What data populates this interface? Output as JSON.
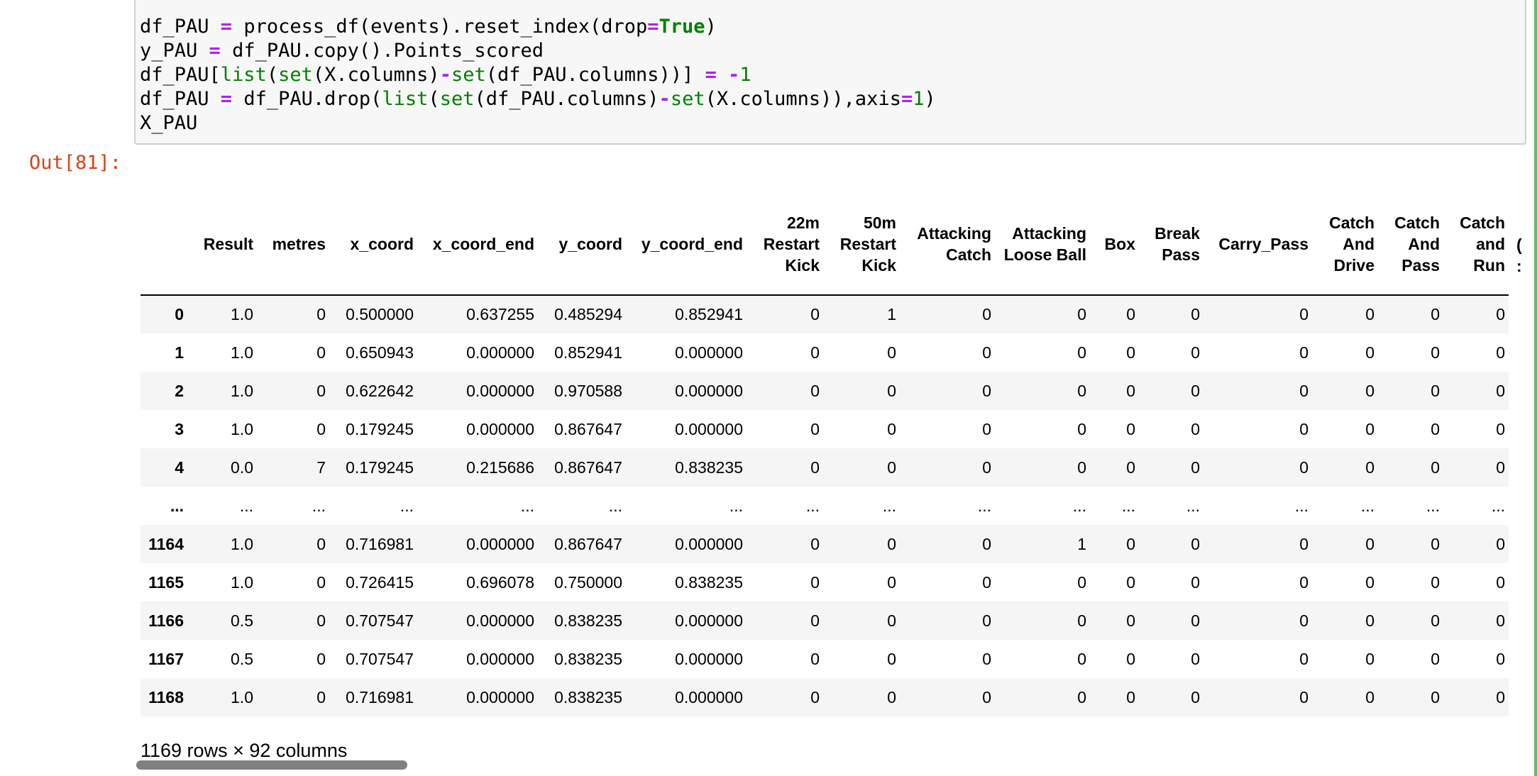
{
  "code_cell": {
    "lines": [
      [
        {
          "t": "df_PAU ",
          "c": ""
        },
        {
          "t": "=",
          "c": "op"
        },
        {
          "t": " process_df(events).reset_index(drop",
          "c": ""
        },
        {
          "t": "=",
          "c": "op"
        },
        {
          "t": "True",
          "c": "kw"
        },
        {
          "t": ")",
          "c": ""
        }
      ],
      [
        {
          "t": "y_PAU ",
          "c": ""
        },
        {
          "t": "=",
          "c": "op"
        },
        {
          "t": " df_PAU.copy().Points_scored",
          "c": ""
        }
      ],
      [
        {
          "t": "df_PAU[",
          "c": ""
        },
        {
          "t": "list",
          "c": "bi"
        },
        {
          "t": "(",
          "c": ""
        },
        {
          "t": "set",
          "c": "bi"
        },
        {
          "t": "(X.columns)",
          "c": ""
        },
        {
          "t": "-",
          "c": "op"
        },
        {
          "t": "set",
          "c": "bi"
        },
        {
          "t": "(df_PAU.columns))] ",
          "c": ""
        },
        {
          "t": "=",
          "c": "op"
        },
        {
          "t": " ",
          "c": ""
        },
        {
          "t": "-",
          "c": "op"
        },
        {
          "t": "1",
          "c": "num"
        }
      ],
      [
        {
          "t": "df_PAU ",
          "c": ""
        },
        {
          "t": "=",
          "c": "op"
        },
        {
          "t": " df_PAU.drop(",
          "c": ""
        },
        {
          "t": "list",
          "c": "bi"
        },
        {
          "t": "(",
          "c": ""
        },
        {
          "t": "set",
          "c": "bi"
        },
        {
          "t": "(df_PAU.columns)",
          "c": ""
        },
        {
          "t": "-",
          "c": "op"
        },
        {
          "t": "set",
          "c": "bi"
        },
        {
          "t": "(X.columns)),axis",
          "c": ""
        },
        {
          "t": "=",
          "c": "op"
        },
        {
          "t": "1",
          "c": "num"
        },
        {
          "t": ")",
          "c": ""
        }
      ],
      [
        {
          "t": "X_PAU",
          "c": ""
        }
      ]
    ]
  },
  "output": {
    "prompt": "Out[81]:",
    "columns": [
      "Result",
      "metres",
      "x_coord",
      "x_coord_end",
      "y_coord",
      "y_coord_end",
      "22m Restart Kick",
      "50m Restart Kick",
      "Attacking Catch",
      "Attacking Loose Ball",
      "Box",
      "Break Pass",
      "Carry_Pass",
      "Catch And Drive",
      "Catch And Pass",
      "Catch and Run"
    ],
    "rows": [
      {
        "index": "0",
        "values": [
          "1.0",
          "0",
          "0.500000",
          "0.637255",
          "0.485294",
          "0.852941",
          "0",
          "1",
          "0",
          "0",
          "0",
          "0",
          "0",
          "0",
          "0",
          "0"
        ]
      },
      {
        "index": "1",
        "values": [
          "1.0",
          "0",
          "0.650943",
          "0.000000",
          "0.852941",
          "0.000000",
          "0",
          "0",
          "0",
          "0",
          "0",
          "0",
          "0",
          "0",
          "0",
          "0"
        ]
      },
      {
        "index": "2",
        "values": [
          "1.0",
          "0",
          "0.622642",
          "0.000000",
          "0.970588",
          "0.000000",
          "0",
          "0",
          "0",
          "0",
          "0",
          "0",
          "0",
          "0",
          "0",
          "0"
        ]
      },
      {
        "index": "3",
        "values": [
          "1.0",
          "0",
          "0.179245",
          "0.000000",
          "0.867647",
          "0.000000",
          "0",
          "0",
          "0",
          "0",
          "0",
          "0",
          "0",
          "0",
          "0",
          "0"
        ]
      },
      {
        "index": "4",
        "values": [
          "0.0",
          "7",
          "0.179245",
          "0.215686",
          "0.867647",
          "0.838235",
          "0",
          "0",
          "0",
          "0",
          "0",
          "0",
          "0",
          "0",
          "0",
          "0"
        ]
      },
      {
        "index": "...",
        "values": [
          "...",
          "...",
          "...",
          "...",
          "...",
          "...",
          "...",
          "...",
          "...",
          "...",
          "...",
          "...",
          "...",
          "...",
          "...",
          "..."
        ]
      },
      {
        "index": "1164",
        "values": [
          "1.0",
          "0",
          "0.716981",
          "0.000000",
          "0.867647",
          "0.000000",
          "0",
          "0",
          "0",
          "1",
          "0",
          "0",
          "0",
          "0",
          "0",
          "0"
        ]
      },
      {
        "index": "1165",
        "values": [
          "1.0",
          "0",
          "0.726415",
          "0.696078",
          "0.750000",
          "0.838235",
          "0",
          "0",
          "0",
          "0",
          "0",
          "0",
          "0",
          "0",
          "0",
          "0"
        ]
      },
      {
        "index": "1166",
        "values": [
          "0.5",
          "0",
          "0.707547",
          "0.000000",
          "0.838235",
          "0.000000",
          "0",
          "0",
          "0",
          "0",
          "0",
          "0",
          "0",
          "0",
          "0",
          "0"
        ]
      },
      {
        "index": "1167",
        "values": [
          "0.5",
          "0",
          "0.707547",
          "0.000000",
          "0.838235",
          "0.000000",
          "0",
          "0",
          "0",
          "0",
          "0",
          "0",
          "0",
          "0",
          "0",
          "0"
        ]
      },
      {
        "index": "1168",
        "values": [
          "1.0",
          "0",
          "0.716981",
          "0.000000",
          "0.838235",
          "0.000000",
          "0",
          "0",
          "0",
          "0",
          "0",
          "0",
          "0",
          "0",
          "0",
          "0"
        ]
      }
    ],
    "shape_text": "1169 rows × 92 columns"
  },
  "colors": {
    "prompt_out": "#d84315",
    "selected_cell_bar": "#66bb6a",
    "code_operator": "#aa22ff",
    "code_keyword": "#008000",
    "row_stripe": "#f5f5f5"
  }
}
